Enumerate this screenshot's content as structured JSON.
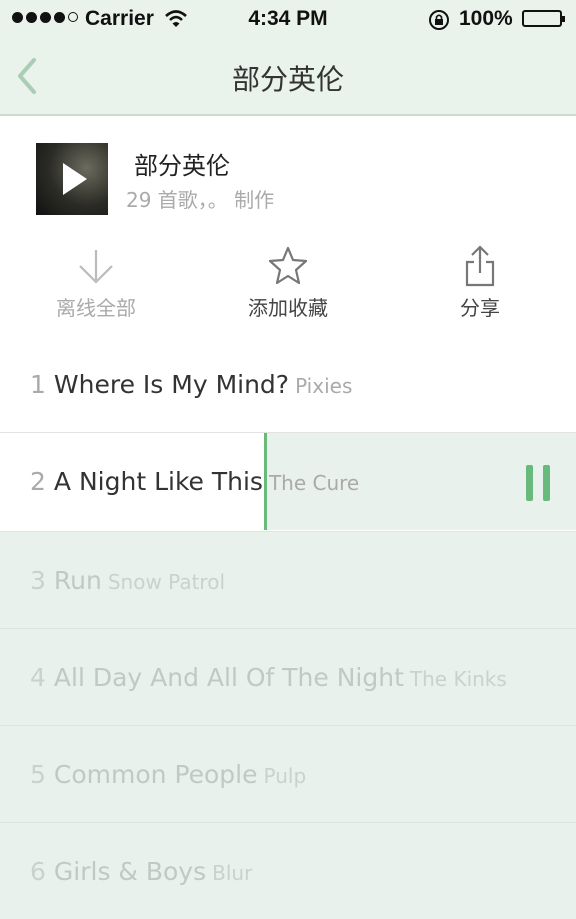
{
  "status_bar": {
    "carrier": "Carrier",
    "time": "4:34 PM",
    "battery": "100%",
    "signal_bars": 4,
    "signal_bars_total": 5
  },
  "nav": {
    "title": "部分英伦",
    "back_icon": "chevron-left-icon"
  },
  "album": {
    "title": "部分英伦",
    "subtitle": "29 首歌，。 制作",
    "play_icon": "play-icon"
  },
  "actions": [
    {
      "label": "离线全部",
      "icon": "download-icon"
    },
    {
      "label": "添加收藏",
      "icon": "star-icon"
    },
    {
      "label": "分享",
      "icon": "share-icon"
    }
  ],
  "tracks": [
    {
      "number": "1",
      "title": "Where Is My Mind?",
      "artist": "Pixies"
    },
    {
      "number": "2",
      "title": "A Night Like This",
      "artist": "The Cure",
      "playing": true
    },
    {
      "number": "3",
      "title": "Run",
      "artist": "Snow Patrol"
    },
    {
      "number": "4",
      "title": "All Day And All Of The Night",
      "artist": "The Kinks"
    },
    {
      "number": "5",
      "title": "Common People",
      "artist": "Pulp"
    },
    {
      "number": "6",
      "title": "Girls & Boys",
      "artist": "Blur"
    }
  ],
  "colors": {
    "accent": "#68b97c",
    "nav_bg": "#e9f3ec",
    "faded_row_bg": "#e8f1eb"
  }
}
